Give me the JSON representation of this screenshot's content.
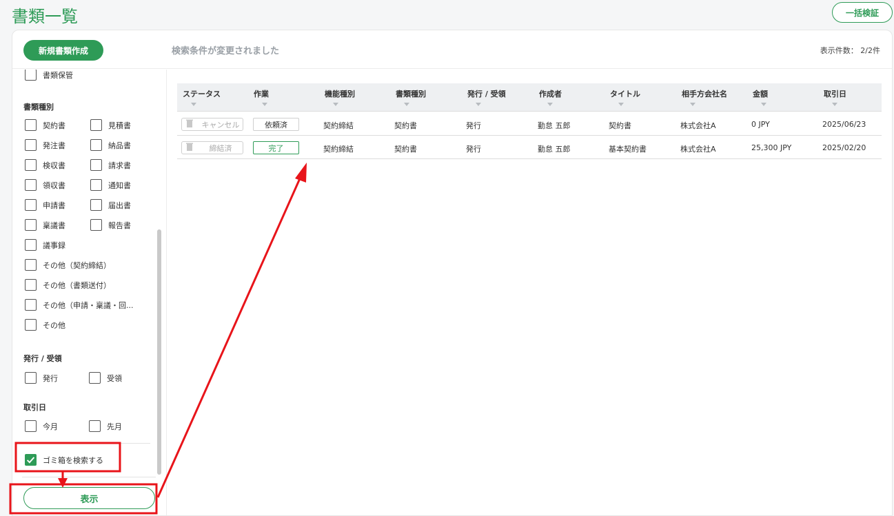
{
  "header": {
    "title": "書類一覧",
    "bulk_verify_label": "一括検証",
    "new_doc_label": "新規書類作成",
    "changed_message": "検索条件が変更されました",
    "count_label": "表示件数： 2/2件"
  },
  "sidebar": {
    "top_item": "書類保管",
    "doc_type_title": "書類種別",
    "doc_types": [
      "契約書",
      "見積書",
      "発注書",
      "納品書",
      "検収書",
      "請求書",
      "領収書",
      "通知書",
      "申請書",
      "届出書",
      "稟議書",
      "報告書",
      "議事録",
      "その他（契約締結）",
      "その他（書類送付）",
      "その他（申請・稟議・回...",
      "その他"
    ],
    "issue_title": "発行 / 受領",
    "issue_items": [
      "発行",
      "受領"
    ],
    "date_title": "取引日",
    "date_items": [
      "今月",
      "先月"
    ],
    "trash_label": "ゴミ箱を検索する",
    "show_label": "表示"
  },
  "table": {
    "columns": [
      "ステータス",
      "作業",
      "機能種別",
      "書類種別",
      "発行 / 受領",
      "作成者",
      "タイトル",
      "相手方会社名",
      "金額",
      "取引日"
    ],
    "rows": [
      {
        "status": "キャンセル",
        "work": "依頼済",
        "func": "契約締結",
        "doctype": "契約書",
        "issue": "発行",
        "author": "勤怠 五郎",
        "title": "契約書",
        "company": "株式会社A",
        "amount": "0 JPY",
        "date": "2025/06/23"
      },
      {
        "status": "締結済",
        "work": "完了",
        "func": "契約締結",
        "doctype": "契約書",
        "issue": "発行",
        "author": "勤怠 五郎",
        "title": "基本契約書",
        "company": "株式会社A",
        "amount": "25,300 JPY",
        "date": "2025/02/20"
      }
    ]
  },
  "colors": {
    "accent": "#2e9b57",
    "annotation": "#e8141a"
  }
}
